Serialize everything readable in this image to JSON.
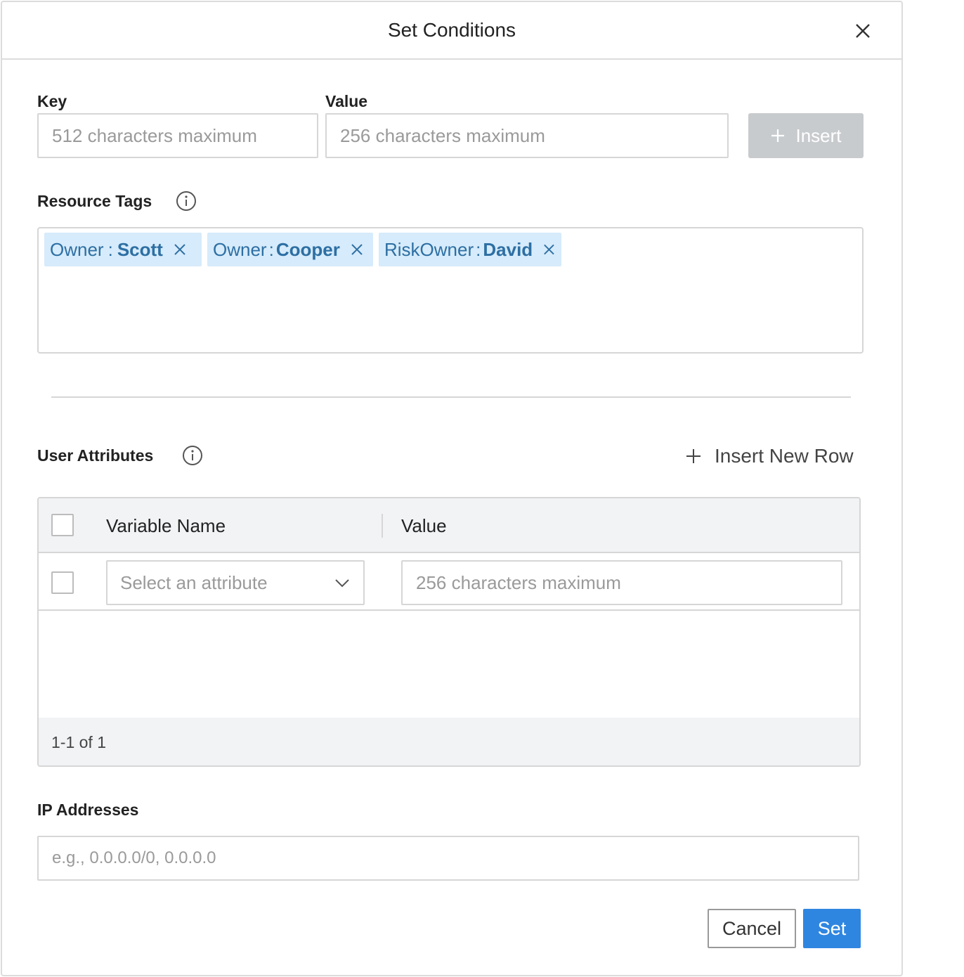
{
  "dialog": {
    "title": "Set Conditions"
  },
  "tag_input": {
    "key_label": "Key",
    "key_placeholder": "512 characters maximum",
    "value_label": "Value",
    "value_placeholder": "256 characters maximum",
    "insert_label": "Insert"
  },
  "resource_tags": {
    "label": "Resource Tags",
    "separator": ":",
    "tags": [
      {
        "key": "Owner",
        "value": "Scott"
      },
      {
        "key": "Owner",
        "value": "Cooper"
      },
      {
        "key": "RiskOwner",
        "value": "David"
      }
    ]
  },
  "user_attributes": {
    "label": "User Attributes",
    "insert_row_label": "Insert New Row",
    "columns": [
      "Variable Name",
      "Value"
    ],
    "rows": [
      {
        "select_placeholder": "Select an attribute",
        "value_placeholder": "256 characters maximum"
      }
    ],
    "pagination": "1-1 of 1"
  },
  "ip_addresses": {
    "label": "IP Addresses",
    "placeholder": "e.g., 0.0.0.0/0, 0.0.0.0"
  },
  "footer": {
    "cancel_label": "Cancel",
    "set_label": "Set"
  },
  "colors": {
    "primary": "#2f86e0",
    "tag_bg": "#d6ebfb",
    "tag_text": "#2d6fa3",
    "disabled_button": "#c8cbce"
  }
}
